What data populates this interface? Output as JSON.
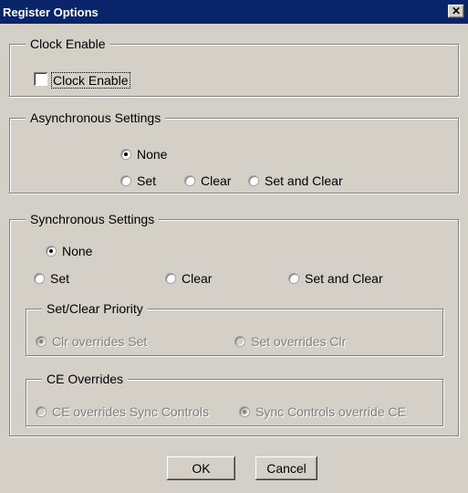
{
  "window": {
    "title": "Register Options",
    "close_label": "✕"
  },
  "clock_enable": {
    "legend": "Clock Enable",
    "checkbox_label": "Clock Enable",
    "checked": false
  },
  "async": {
    "legend": "Asynchronous Settings",
    "options": [
      "None",
      "Set",
      "Clear",
      "Set and Clear"
    ],
    "selected": "None"
  },
  "sync": {
    "legend": "Synchronous Settings",
    "options": [
      "None",
      "Set",
      "Clear",
      "Set and Clear"
    ],
    "selected": "None",
    "priority": {
      "legend": "Set/Clear Priority",
      "options": [
        "Clr overrides Set",
        "Set overrides Clr"
      ],
      "selected": "Clr overrides Set",
      "enabled": false
    },
    "ce_overrides": {
      "legend": "CE Overrides",
      "options": [
        "CE overrides Sync Controls",
        "Sync Controls override CE"
      ],
      "selected": "Sync Controls override CE",
      "enabled": false
    }
  },
  "buttons": {
    "ok": "OK",
    "cancel": "Cancel"
  }
}
